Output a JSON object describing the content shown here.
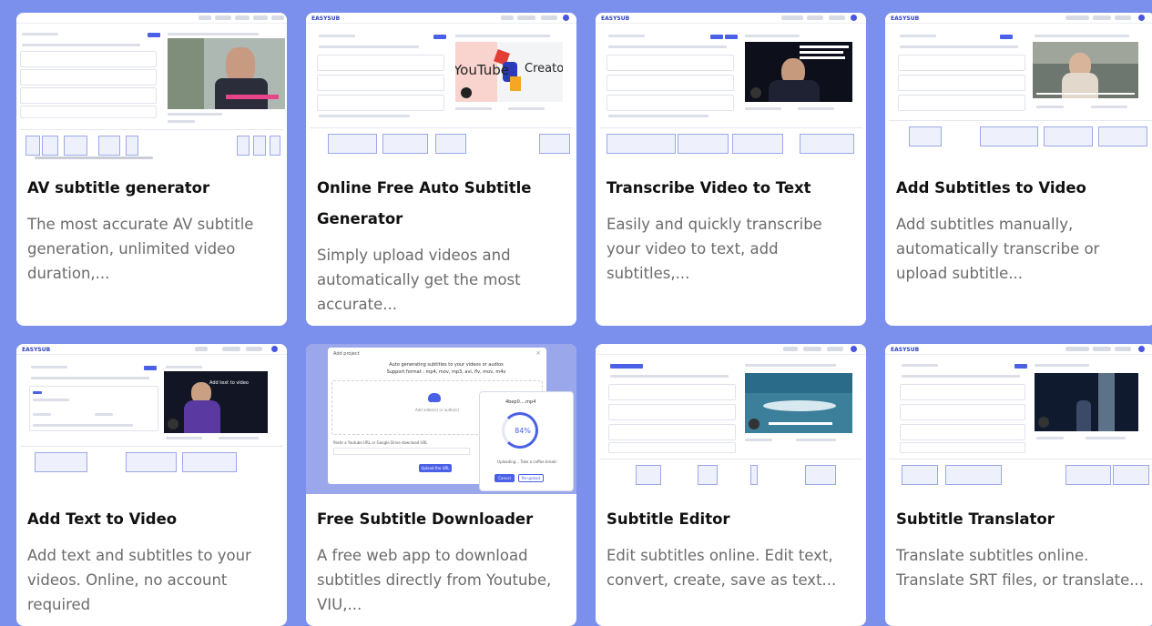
{
  "cards": [
    {
      "title": "AV subtitle generator",
      "desc": "The most accurate AV subtitle generation, unlimited video duration,..."
    },
    {
      "title": "Online Free Auto Subtitle Generator",
      "desc": "Simply upload videos and automatically get the most accurate..."
    },
    {
      "title": "Transcribe Video to Text",
      "desc": "Easily and quickly transcribe your video to text, add subtitles,..."
    },
    {
      "title": "Add Subtitles to Video",
      "desc": "Add subtitles manually, automatically transcribe or upload subtitle..."
    },
    {
      "title": "Add Text to Video",
      "desc": "Add text and subtitles to your videos. Online, no account required"
    },
    {
      "title": "Free Subtitle Downloader",
      "desc": "A free web app to download subtitles directly from Youtube, VIU,..."
    },
    {
      "title": "Subtitle Editor",
      "desc": "Edit subtitles online. Edit text, convert, create, save as text..."
    },
    {
      "title": "Subtitle Translator",
      "desc": "Translate subtitles online. Translate SRT files, or translate..."
    }
  ],
  "thumbs": {
    "logo": "EASYSUB",
    "youtube_word": "YouTube",
    "creator_word": "Creator",
    "add_text_overlay": "Add text to video",
    "add_project": "Add project",
    "upload_heading": "Auto generating subtitles to your videos or audios",
    "upload_formats": "Support format : mp4, mov, mp3, avi, flv, mov, m4v",
    "upload_hint": "Add video(s) or audio(s)",
    "upload_percent": "84%",
    "upload_file": "4bep0....mp4",
    "uploading_text": "Uploading... Take a coffee break!",
    "cancel_label": "Cancel",
    "reupload_label": "Re-upload",
    "submit_url": "Upload the URL",
    "paste_label": "Paste a Youtube URL or Google Drive download URL"
  }
}
